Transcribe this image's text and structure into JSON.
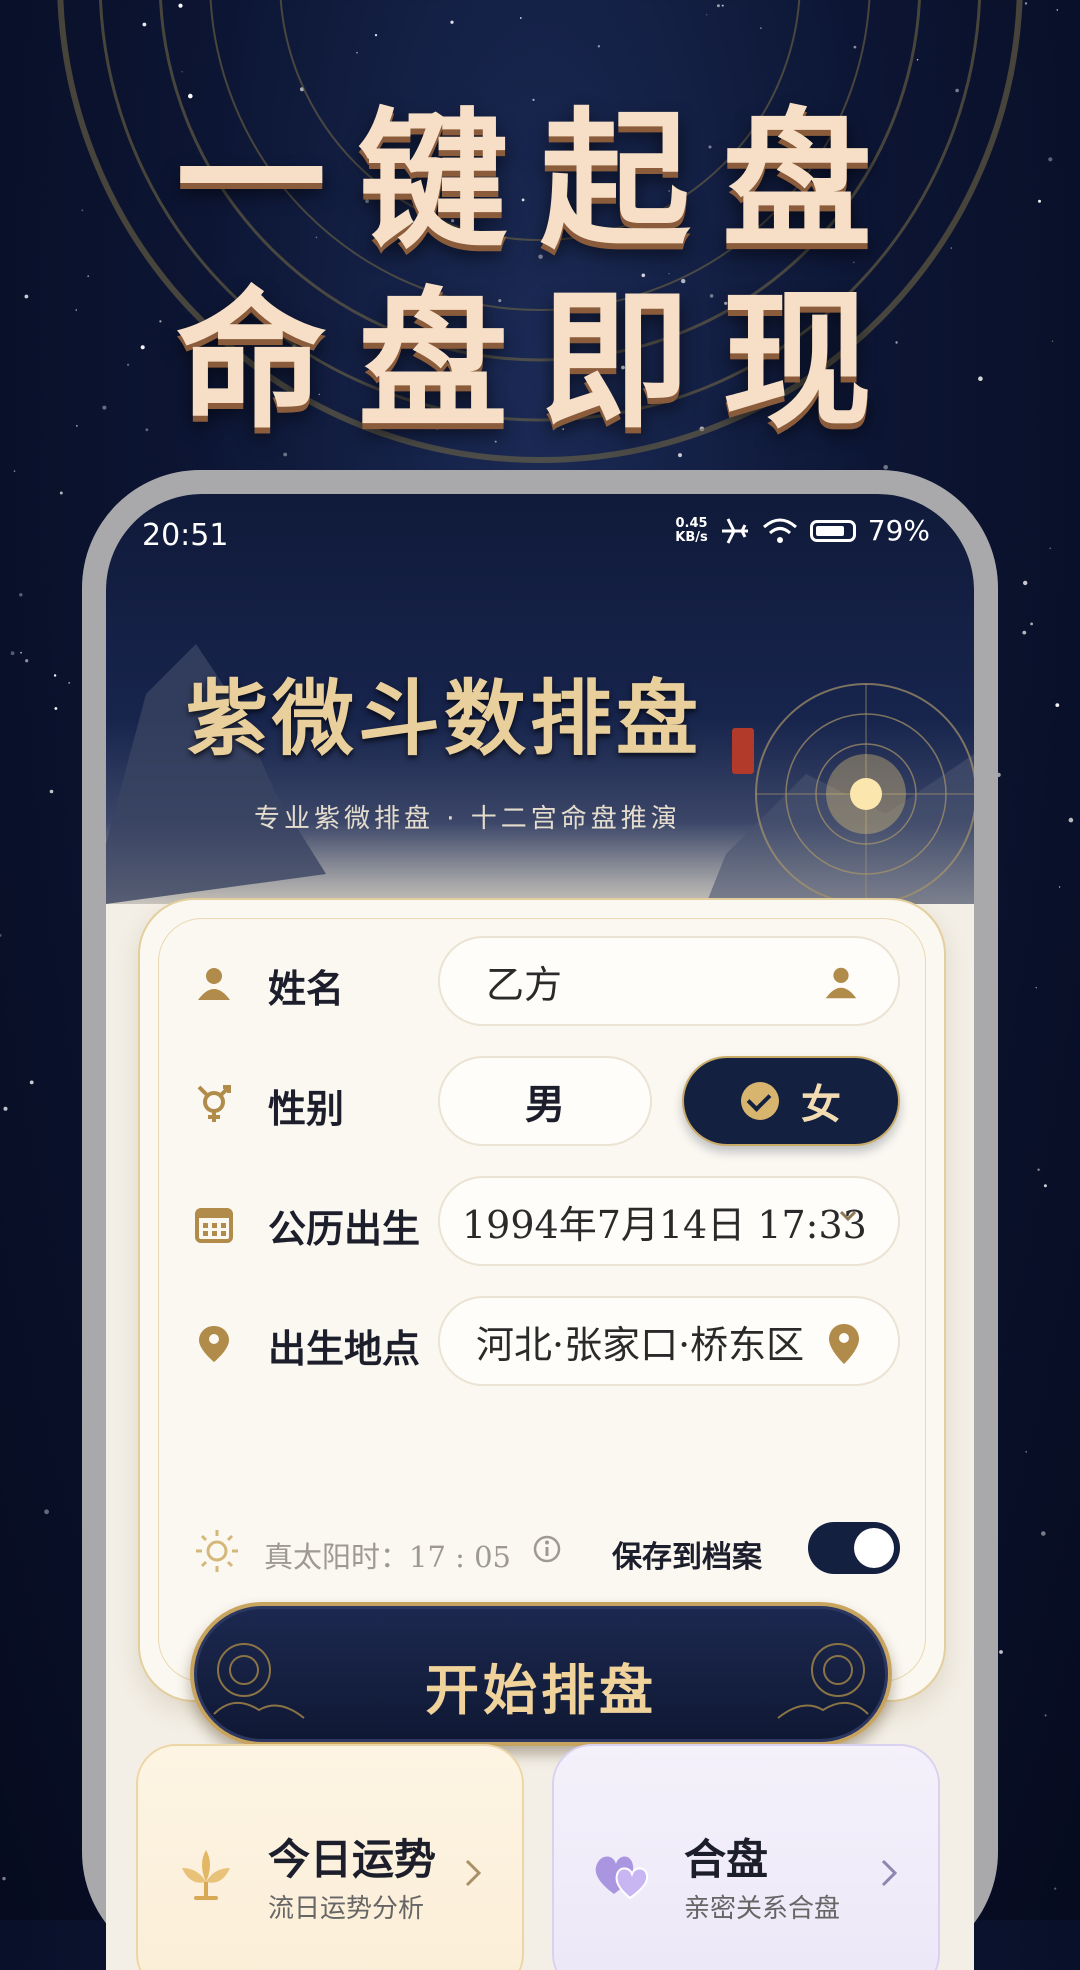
{
  "promo": {
    "line1": "一键起盘",
    "line2": "命盘即现"
  },
  "status_bar": {
    "time": "20:51",
    "net_speed_value": "0.45",
    "net_speed_unit": "KB/s",
    "battery": "79%"
  },
  "banner": {
    "title": "紫微斗数排盘",
    "subtitle": "专业紫微排盘 · 十二宫命盘推演"
  },
  "form": {
    "name": {
      "label": "姓名",
      "value": "乙方"
    },
    "gender": {
      "label": "性别",
      "male": "男",
      "female": "女",
      "selected": "女"
    },
    "birth_date": {
      "label": "公历出生",
      "value": "1994年7月14日 17:33"
    },
    "birth_place": {
      "label": "出生地点",
      "value": "河北·张家口·桥东区"
    },
    "solar_time": {
      "text": "真太阳时：17 : 05"
    },
    "save_profile": {
      "label": "保存到档案",
      "enabled": true
    },
    "submit_label": "开始排盘"
  },
  "quick_cards": [
    {
      "title": "今日运势",
      "subtitle": "流日运势分析",
      "icon": "lotus-icon"
    },
    {
      "title": "合盘",
      "subtitle": "亲密关系合盘",
      "icon": "hearts-icon"
    }
  ],
  "colors": {
    "navy": "#14203f",
    "gold": "#d8b56e",
    "cream": "#fbf8f1"
  }
}
